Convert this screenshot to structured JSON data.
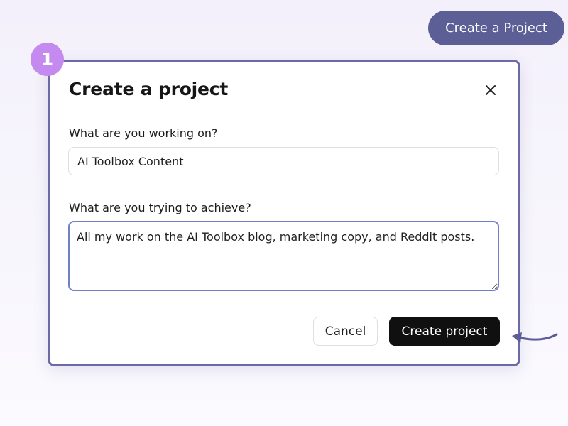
{
  "header": {
    "cta_label": "Create a Project"
  },
  "step": {
    "number": "1"
  },
  "dialog": {
    "title": "Create a project",
    "close_icon": "close-icon",
    "fields": {
      "working_on": {
        "label": "What are you working on?",
        "value": "AI Toolbox Content"
      },
      "achieve": {
        "label": "What are you trying to achieve?",
        "value": "All my work on the AI Toolbox blog, marketing copy, and Reddit posts."
      }
    },
    "buttons": {
      "cancel_label": "Cancel",
      "create_label": "Create project"
    }
  },
  "colors": {
    "accent_pill": "#5c5f96",
    "step_badge": "#c58af0",
    "dialog_border": "#6b6aa6",
    "primary_button": "#101010",
    "focus_ring": "#6f82c9"
  }
}
